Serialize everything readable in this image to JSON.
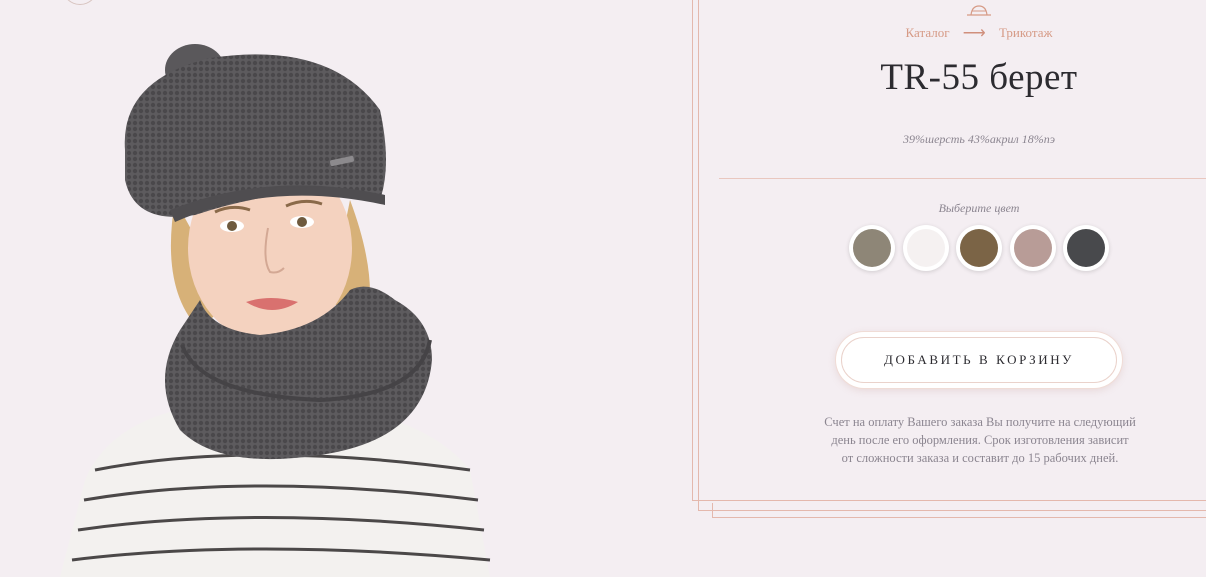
{
  "breadcrumb": {
    "catalog": "Каталог",
    "arrow": "⟶",
    "category": "Трикотаж"
  },
  "product": {
    "title": "TR-55 берет",
    "composition": "39%шерсть 43%акрил 18%пэ"
  },
  "color_picker": {
    "label": "Выберите цвет",
    "colors": [
      {
        "name": "beige-gray",
        "hex": "#8e8677"
      },
      {
        "name": "white",
        "hex": "#f5f1f1"
      },
      {
        "name": "brown",
        "hex": "#7b6446"
      },
      {
        "name": "dusty-pink",
        "hex": "#b89c97"
      },
      {
        "name": "dark-gray",
        "hex": "#48494c"
      }
    ]
  },
  "cart": {
    "add_label": "ДОБАВИТЬ В КОРЗИНУ"
  },
  "note": {
    "lines": [
      "Счет на оплату Вашего заказа Вы получите на следующий",
      "день после его оформления. Срок изготовления зависит",
      "от сложности заказа и составит до 15 рабочих дней."
    ]
  },
  "theme": {
    "accent": "#d69a86",
    "background": "#f4eef2",
    "text": "#2c2b30"
  }
}
